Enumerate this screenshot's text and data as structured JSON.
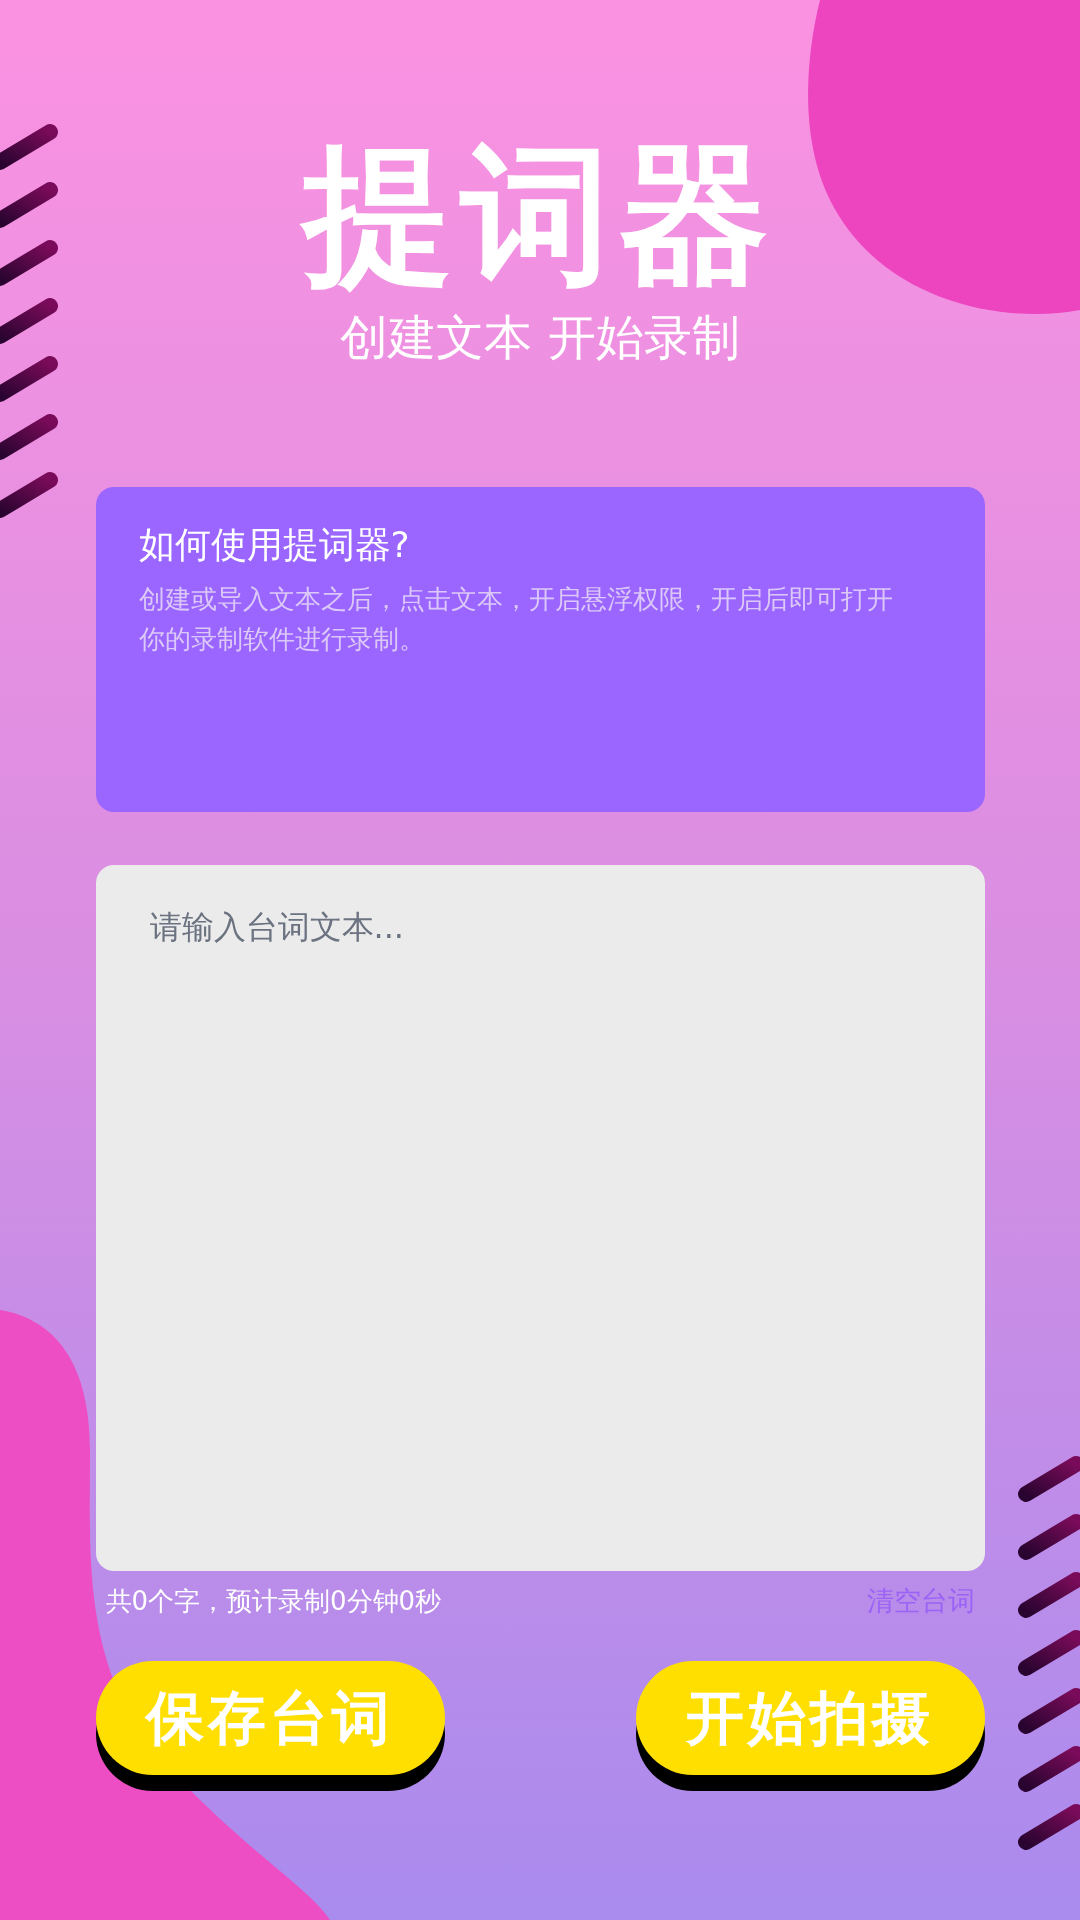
{
  "title": "提词器",
  "subtitle": "创建文本 开始录制",
  "help": {
    "title": "如何使用提词器?",
    "body": "创建或导入文本之后，点击文本，开启悬浮权限，开启后即可打开你的录制软件进行录制。"
  },
  "script_field": {
    "placeholder": "请输入台词文本..."
  },
  "stats": "共0个字，预计录制0分钟0秒",
  "clear_button": "清空台词",
  "buttons": [
    {
      "label": "保存台词"
    },
    {
      "label": "开始拍摄"
    }
  ]
}
